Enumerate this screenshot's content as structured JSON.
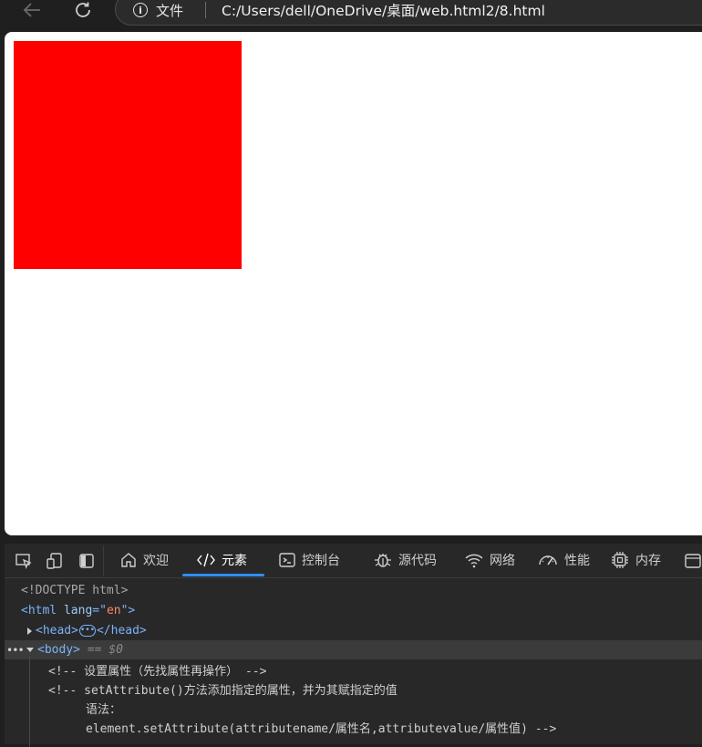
{
  "browser": {
    "address_label": "文件",
    "url": "C:/Users/dell/OneDrive/桌面/web.html2/8.html"
  },
  "page": {
    "box_color": "#ff0000"
  },
  "devtools": {
    "tabs": [
      {
        "label": "欢迎",
        "icon": "home-icon"
      },
      {
        "label": "元素",
        "icon": "code-brackets-icon"
      },
      {
        "label": "控制台",
        "icon": "console-icon"
      },
      {
        "label": "源代码",
        "icon": "bug-icon"
      },
      {
        "label": "网络",
        "icon": "wifi-icon"
      },
      {
        "label": "性能",
        "icon": "gauge-icon"
      },
      {
        "label": "内存",
        "icon": "chip-icon"
      }
    ],
    "active_tab": "元素",
    "accent_color": "#2f8ef4",
    "dom": {
      "doctype": "<!DOCTYPE html>",
      "html_open": "<html",
      "html_attr_name": "lang",
      "html_attr_eq": "=\"",
      "html_attr_value": "en",
      "html_attr_close": "\">",
      "head_open": "<head>",
      "head_ellipsis": "•••",
      "head_close": "</head>",
      "body_open": "<body>",
      "body_selected_marker": "== $0",
      "comment_1": "<!-- 设置属性（先找属性再操作） -->",
      "comment_2a": "<!-- setAttribute()方法添加指定的属性，并为其赋指定的值",
      "comment_2b": "语法：",
      "comment_2c": "element.setAttribute(attributename/属性名,attributevalue/属性值) -->"
    }
  }
}
